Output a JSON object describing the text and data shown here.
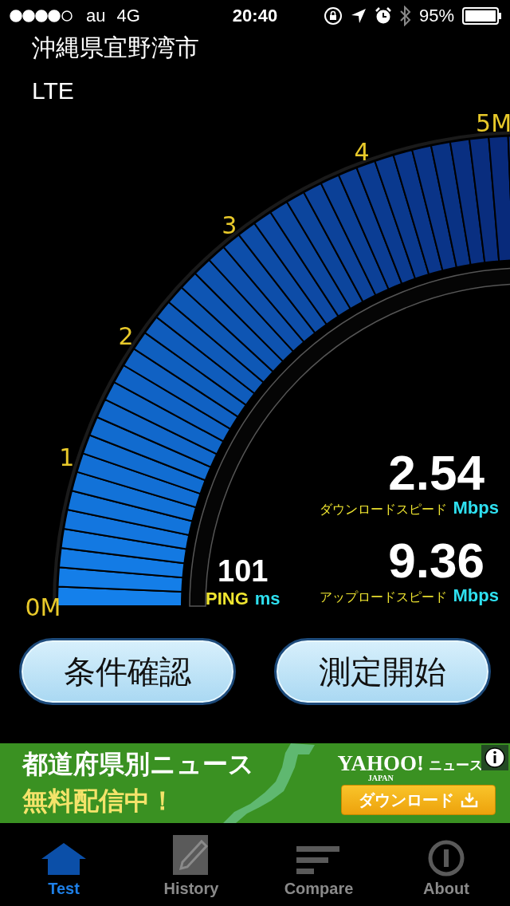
{
  "status_bar": {
    "carrier": "au",
    "network": "4G",
    "time": "20:40",
    "battery": "95%"
  },
  "location": "沖縄県宜野湾市",
  "connection": "LTE",
  "gauge": {
    "tick_labels": [
      "0M",
      "1",
      "2",
      "3",
      "4",
      "5M"
    ]
  },
  "ping": {
    "value": "101",
    "label": "PING",
    "unit": "ms"
  },
  "download": {
    "value": "2.54",
    "label": "ダウンロードスピード",
    "unit": "Mbps"
  },
  "upload": {
    "value": "9.36",
    "label": "アップロードスピード",
    "unit": "Mbps"
  },
  "buttons": [
    "条件確認",
    "測定開始"
  ],
  "ad": {
    "headline": "都道府県別ニュース",
    "subline": "無料配信中！",
    "brand": "YAHOO!",
    "brand_sub": "JAPAN",
    "brand_suffix": "ニュース",
    "button": "ダウンロード"
  },
  "tabs": [
    {
      "label": "Test",
      "kind": "home",
      "selected": true
    },
    {
      "label": "History",
      "kind": "notepad",
      "selected": false
    },
    {
      "label": "Compare",
      "kind": "bars",
      "selected": false
    },
    {
      "label": "About",
      "kind": "info",
      "selected": false
    }
  ]
}
